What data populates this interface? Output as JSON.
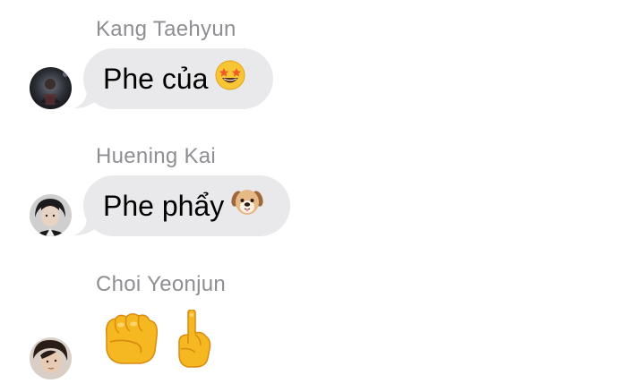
{
  "messages": [
    {
      "sender": "Kang Taehyun",
      "text": "Phe của",
      "emoji": "star-struck-emoji"
    },
    {
      "sender": "Huening Kai",
      "text": "Phe phẩy",
      "emoji": "dog-face-emoji"
    },
    {
      "sender": "Choi Yeonjun",
      "text": "",
      "emoji": [
        "oncoming-fist-emoji",
        "pointing-up-emoji"
      ]
    }
  ],
  "colors": {
    "bubble": "#e9e9eb",
    "sender_name": "#8e8e93",
    "text": "#000000",
    "background": "#ffffff"
  }
}
